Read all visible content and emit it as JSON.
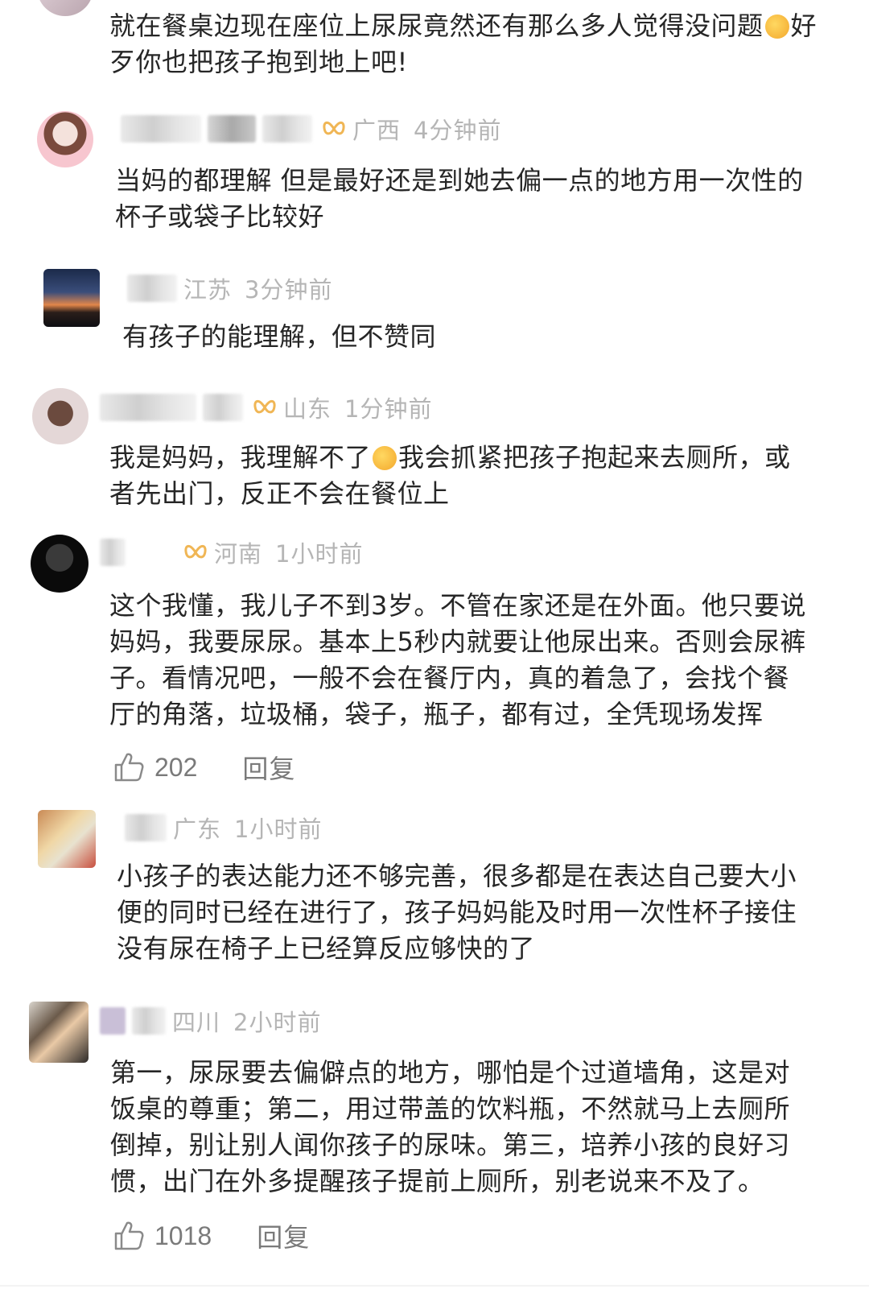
{
  "comments": [
    {
      "region": "",
      "time": "",
      "text": "就在餐桌边现在座位上尿尿竟然还有那么多人觉得没问题",
      "text_after_emoji": "好歹你也把孩子抱到地上吧!"
    },
    {
      "region": "广西",
      "time": "4分钟前",
      "text": "当妈的都理解 但是最好还是到她去偏一点的地方用一次性的杯子或袋子比较好"
    },
    {
      "region": "江苏",
      "time": "3分钟前",
      "text": "有孩子的能理解，但不赞同"
    },
    {
      "region": "山东",
      "time": "1分钟前",
      "text": "我是妈妈，我理解不了",
      "text_after_emoji": "我会抓紧把孩子抱起来去厕所，或者先出门，反正不会在餐位上"
    },
    {
      "region": "河南",
      "time": "1小时前",
      "text": "这个我懂，我儿子不到3岁。不管在家还是在外面。他只要说妈妈，我要尿尿。基本上5秒内就要让他尿出来。否则会尿裤子。看情况吧，一般不会在餐厅内，真的着急了，会找个餐厅的角落，垃圾桶，袋子，瓶子，都有过，全凭现场发挥",
      "likes": "202",
      "reply": "回复"
    },
    {
      "region": "广东",
      "time": "1小时前",
      "text": "小孩子的表达能力还不够完善，很多都是在表达自己要大小便的同时已经在进行了，孩子妈妈能及时用一次性杯子接住没有尿在椅子上已经算反应够快的了"
    },
    {
      "region": "四川",
      "time": "2小时前",
      "text": "第一，尿尿要去偏僻点的地方，哪怕是个过道墙角，这是对饭桌的尊重；第二，用过带盖的饮料瓶，不然就马上去厕所倒掉，别让别人闻你孩子的尿味。第三，培养小孩的良好习惯，出门在外多提醒孩子提前上厕所，别老说来不及了。",
      "likes": "1018",
      "reply": "回复"
    }
  ],
  "icons": {
    "badge": "vip-bow-badge-icon",
    "like": "thumbs-up-icon",
    "emoji": "crying-face-emoji-icon"
  },
  "colors": {
    "badge": "#f0b655",
    "meta_text": "#b5b5b5",
    "body_text": "#262626",
    "action_text": "#7a7a7a"
  }
}
